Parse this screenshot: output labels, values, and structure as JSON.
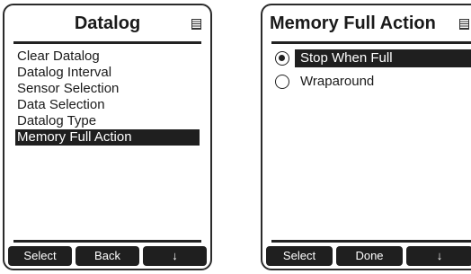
{
  "left_screen": {
    "title": "Datalog",
    "menu_items": [
      {
        "label": "Clear Datalog"
      },
      {
        "label": "Datalog Interval"
      },
      {
        "label": "Sensor Selection"
      },
      {
        "label": "Data Selection"
      },
      {
        "label": "Datalog Type"
      },
      {
        "label": "Memory Full Action",
        "selected": true
      }
    ],
    "softkeys": [
      "Select",
      "Back",
      "↓"
    ]
  },
  "right_screen": {
    "title": "Memory Full Action",
    "options": [
      {
        "label": "Stop When Full",
        "checked": true,
        "selected": true
      },
      {
        "label": "Wraparound",
        "checked": false,
        "selected": false
      }
    ],
    "softkeys": [
      "Select",
      "Done",
      "↓"
    ]
  },
  "icons": {
    "menu": "menu-icon"
  }
}
